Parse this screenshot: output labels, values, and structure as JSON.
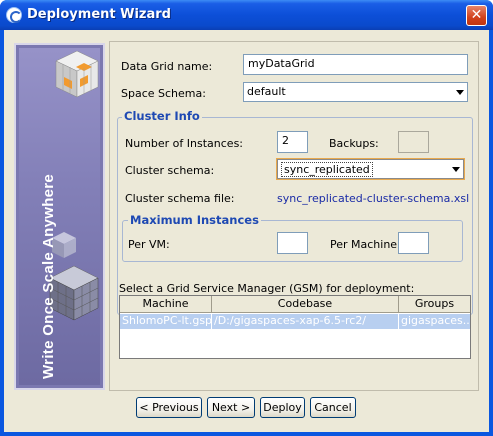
{
  "window": {
    "title": "Deployment Wizard",
    "close_glyph": "✕"
  },
  "banner": {
    "text": "Write Once Scale Anywhere"
  },
  "form": {
    "data_grid_name_label": "Data Grid name:",
    "data_grid_name_value": "myDataGrid",
    "space_schema_label": "Space Schema:",
    "space_schema_value": "default",
    "cluster_info_title": "Cluster Info",
    "num_instances_label": "Number of Instances:",
    "num_instances_value": "2",
    "backups_label": "Backups:",
    "backups_value": "",
    "cluster_schema_label": "Cluster schema:",
    "cluster_schema_value": "sync_replicated",
    "cluster_schema_file_label": "Cluster schema file:",
    "cluster_schema_file_value": "sync_replicated-cluster-schema.xsl",
    "max_instances_title": "Maximum Instances",
    "per_vm_label": "Per VM:",
    "per_vm_value": "",
    "per_machine_label": "Per Machine:",
    "per_machine_value": ""
  },
  "gsm": {
    "label": "Select a Grid Service Manager (GSM) for deployment:",
    "columns": [
      "Machine",
      "Codebase",
      "Groups"
    ],
    "rows": [
      {
        "machine": "ShlomoPC-lt.gsp...",
        "codebase": "/D:/gigaspaces-xap-6.5-rc2/",
        "groups": "gigaspaces..."
      }
    ]
  },
  "buttons": {
    "previous": "< Previous",
    "next": "Next >",
    "deploy": "Deploy",
    "cancel": "Cancel"
  },
  "colors": {
    "title_bar": "#0a4acc",
    "client_bg": "#ece9d8",
    "group_title": "#1e49b3",
    "link": "#1a2ba6",
    "selection": "#b8cff0",
    "banner": "#7b78b0"
  }
}
